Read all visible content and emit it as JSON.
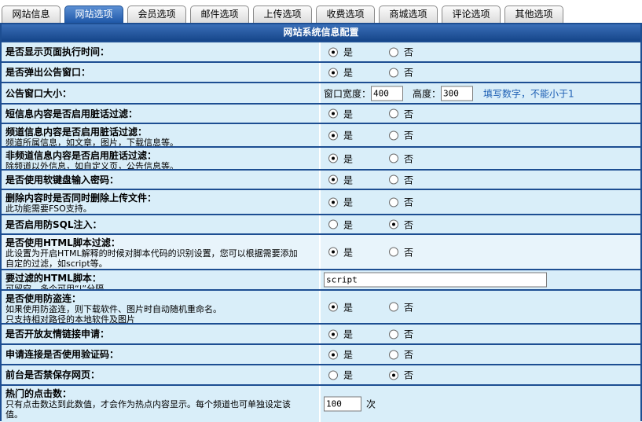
{
  "tabs": [
    {
      "label": "网站信息",
      "active": false
    },
    {
      "label": "网站选项",
      "active": true
    },
    {
      "label": "会员选项",
      "active": false
    },
    {
      "label": "邮件选项",
      "active": false
    },
    {
      "label": "上传选项",
      "active": false
    },
    {
      "label": "收费选项",
      "active": false
    },
    {
      "label": "商城选项",
      "active": false
    },
    {
      "label": "评论选项",
      "active": false
    },
    {
      "label": "其他选项",
      "active": false
    }
  ],
  "section_title": "网站系统信息配置",
  "radio_labels": {
    "yes": "是",
    "no": "否"
  },
  "rows": [
    {
      "title": "是否显示页面执行时间：",
      "desc": [],
      "type": "radio",
      "value": "yes"
    },
    {
      "title": "是否弹出公告窗口：",
      "desc": [],
      "type": "radio",
      "value": "yes"
    },
    {
      "title": "公告窗口大小：",
      "desc": [],
      "type": "size",
      "width_label": "窗口宽度：",
      "width_value": "400",
      "height_label": "高度：",
      "height_value": "300",
      "hint": "填写数字，不能小于1"
    },
    {
      "title": "短信息内容是否启用脏话过滤：",
      "desc": [],
      "type": "radio",
      "value": "yes"
    },
    {
      "title": "频道信息内容是否启用脏话过滤：",
      "desc": [
        "频道所属信息，如文章，图片，下载信息等。"
      ],
      "type": "radio",
      "value": "yes"
    },
    {
      "title": "非频道信息内容是否启用脏话过滤：",
      "desc": [
        "除频道以外信息，如自定义页，公告信息等。"
      ],
      "type": "radio",
      "value": "yes"
    },
    {
      "title": "是否使用软键盘输入密码：",
      "desc": [],
      "type": "radio",
      "value": "yes"
    },
    {
      "title": "删除内容时是否同时删除上传文件：",
      "desc": [
        "此功能需要FSO支持。"
      ],
      "type": "radio",
      "value": "yes"
    },
    {
      "title": "是否启用防SQL注入：",
      "desc": [],
      "type": "radio",
      "value": "no"
    },
    {
      "title": "是否使用HTML脚本过滤：",
      "desc": [
        "此设置为开启HTML解释的时候对脚本代码的识别设置，您可以根据需要添加",
        "自定的过滤，如script等。"
      ],
      "type": "radio",
      "value": "yes"
    },
    {
      "title": "要过滤的HTML脚本：",
      "desc": [
        "可留空，多个可用“|”分隔。"
      ],
      "type": "text",
      "value": "script"
    },
    {
      "title": "是否使用防盗连：",
      "desc": [
        "如果使用防盗连，则下载软件、图片时自动随机重命名。",
        "只支持相对路径的本地软件及图片"
      ],
      "type": "radio",
      "value": "yes"
    },
    {
      "title": "是否开放友情链接申请：",
      "desc": [],
      "type": "radio",
      "value": "yes"
    },
    {
      "title": "申请连接是否使用验证码：",
      "desc": [],
      "type": "radio",
      "value": "yes"
    },
    {
      "title": "前台是否禁保存网页：",
      "desc": [],
      "type": "radio",
      "value": "no"
    },
    {
      "title": "热门的点击数：",
      "desc": [
        "只有点击数达到此数值，才会作为热点内容显示。每个频道也可单独设定该",
        "值。"
      ],
      "type": "number",
      "value": "100",
      "suffix": "次"
    }
  ]
}
